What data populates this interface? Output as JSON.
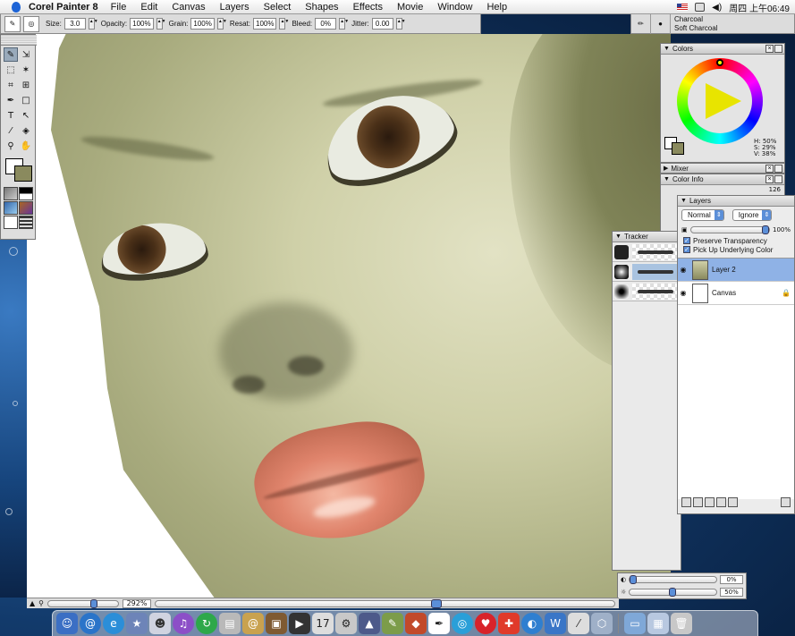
{
  "menubar": {
    "app_name": "Corel Painter 8",
    "menus": [
      "File",
      "Edit",
      "Canvas",
      "Layers",
      "Select",
      "Shapes",
      "Effects",
      "Movie",
      "Window",
      "Help"
    ],
    "clock": "周四 上午06:49"
  },
  "property_bar": {
    "size_label": "Size:",
    "size_value": "3.0",
    "opacity_label": "Opacity:",
    "opacity_value": "100%",
    "grain_label": "Grain:",
    "grain_value": "100%",
    "resat_label": "Resat:",
    "resat_value": "100%",
    "bleed_label": "Bleed:",
    "bleed_value": "0%",
    "jitter_label": "Jitter:",
    "jitter_value": "0.00"
  },
  "brush_selector": {
    "category": "Charcoal",
    "variant": "Soft Charcoal"
  },
  "colors_panel": {
    "title": "Colors",
    "h": "H: 50%",
    "s": "S: 29%",
    "v": "V: 38%"
  },
  "mixer_panel": {
    "title": "Mixer"
  },
  "color_info_panel": {
    "title": "Color Info",
    "value": "126"
  },
  "tracker_panel": {
    "title": "Tracker"
  },
  "layers_panel": {
    "title": "Layers",
    "composite_method": "Normal",
    "depth_method": "Ignore",
    "opacity_value": "100%",
    "preserve_transparency": "Preserve Transparency",
    "pick_up_underlying": "Pick Up Underlying Color",
    "layers": [
      {
        "name": "Layer 2",
        "selected": true
      },
      {
        "name": "Canvas",
        "selected": false
      }
    ]
  },
  "brightness_panel": {
    "value1": "0%",
    "value2": "50%"
  },
  "canvas_status": {
    "zoom": "292%"
  },
  "colors": {
    "primary": "#ffffff",
    "secondary": "#8a8a5e",
    "selection": "#8fb2e6"
  }
}
